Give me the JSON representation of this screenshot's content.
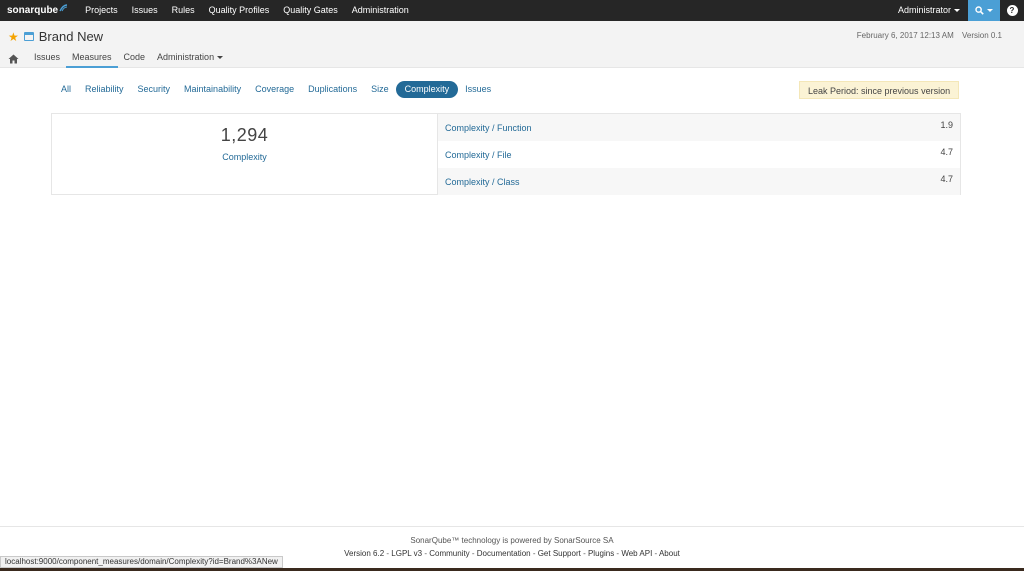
{
  "topnav": {
    "logo": "sonarqube",
    "items": [
      "Projects",
      "Issues",
      "Rules",
      "Quality Profiles",
      "Quality Gates",
      "Administration"
    ],
    "user": "Administrator"
  },
  "project": {
    "name": "Brand New",
    "date": "February 6, 2017 12:13 AM",
    "version": "Version 0.1",
    "tabs": [
      "Issues",
      "Measures",
      "Code",
      "Administration"
    ]
  },
  "domains": {
    "tabs": [
      "All",
      "Reliability",
      "Security",
      "Maintainability",
      "Coverage",
      "Duplications",
      "Size",
      "Complexity",
      "Issues"
    ],
    "active": "Complexity",
    "leak_period": "Leak Period: since previous version"
  },
  "measures": {
    "main_value": "1,294",
    "main_label": "Complexity",
    "rows": [
      {
        "label": "Complexity / Function",
        "value": "1.9"
      },
      {
        "label": "Complexity / File",
        "value": "4.7"
      },
      {
        "label": "Complexity / Class",
        "value": "4.7"
      }
    ]
  },
  "footer": {
    "line1": "SonarQube™ technology is powered by SonarSource SA",
    "links": [
      "Version 6.2",
      "LGPL v3",
      "Community",
      "Documentation",
      "Get Support",
      "Plugins",
      "Web API",
      "About"
    ]
  },
  "statusbar": "localhost:9000/component_measures/domain/Complexity?id=Brand%3ANew",
  "colors": {
    "accent": "#236a97",
    "navbar": "#262626",
    "search": "#4b9fd5",
    "star": "#f4a300",
    "leak_bg": "#fbf3d5"
  }
}
